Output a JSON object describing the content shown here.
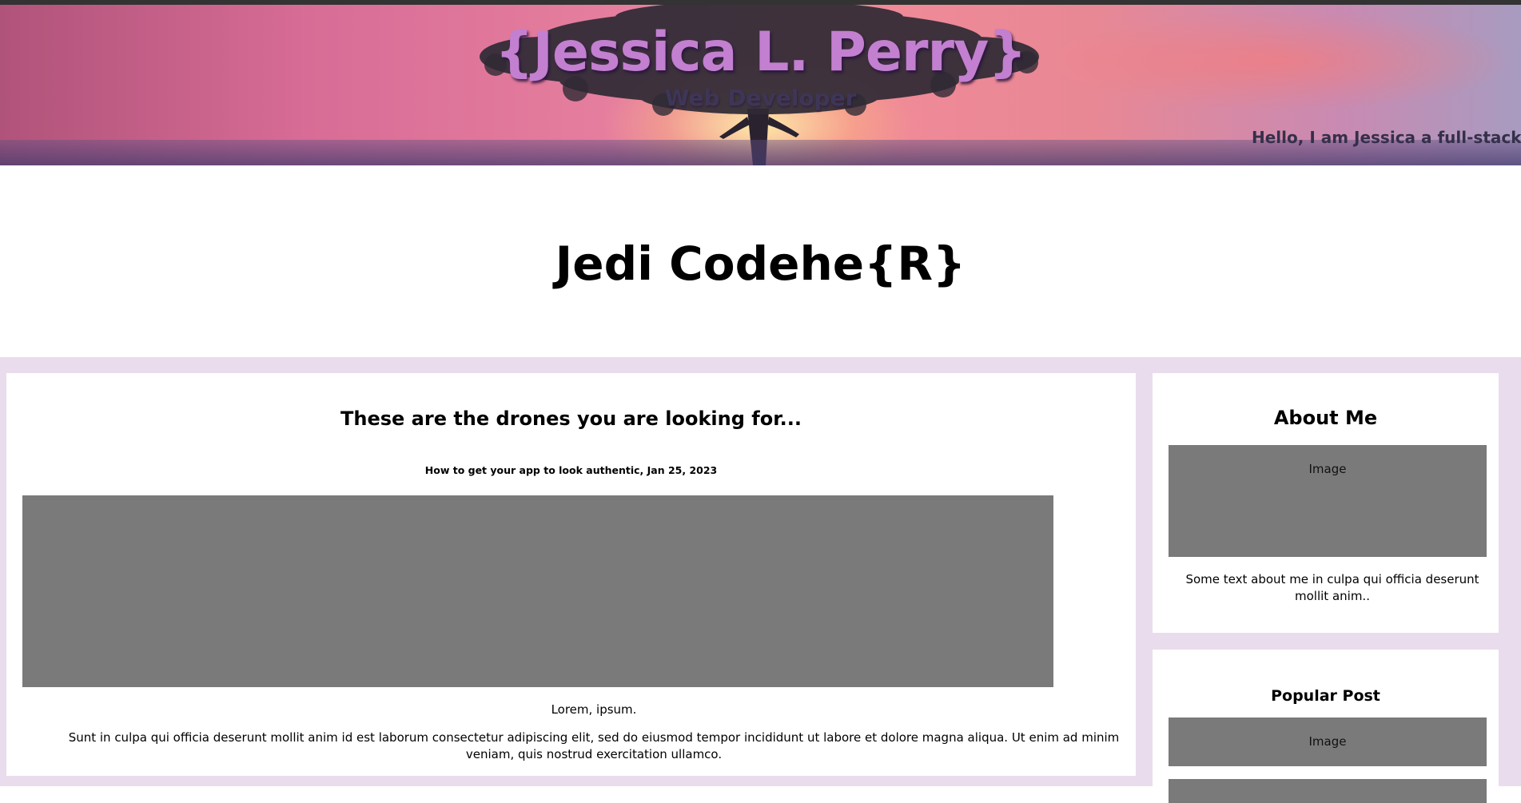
{
  "header": {
    "name": "{Jessica L. Perry}",
    "role": "Web Developer",
    "marquee": "Hello, I am Jessica a full-stack M"
  },
  "site": {
    "title": "Jedi Codehe{R}"
  },
  "post": {
    "title": "These are the drones you are looking for...",
    "meta": "How to get your app to look authentic, Jan 25, 2023",
    "caption": "Lorem, ipsum.",
    "body": "Sunt in culpa qui officia deserunt mollit anim id est laborum consectetur adipiscing elit, sed do eiusmod tempor incididunt ut labore et dolore magna aliqua. Ut enim ad minim veniam, quis nostrud exercitation ullamco."
  },
  "sidebar": {
    "about": {
      "heading": "About Me",
      "image_label": "Image",
      "text": "Some text about me in culpa qui officia deserunt mollit anim.."
    },
    "popular": {
      "heading": "Popular Post",
      "image_label": "Image"
    }
  },
  "colors": {
    "page_bg": "#e9dcec",
    "name_color": "#c37fd0",
    "placeholder_gray": "#7a7a7a",
    "top_strip": "#333333"
  }
}
